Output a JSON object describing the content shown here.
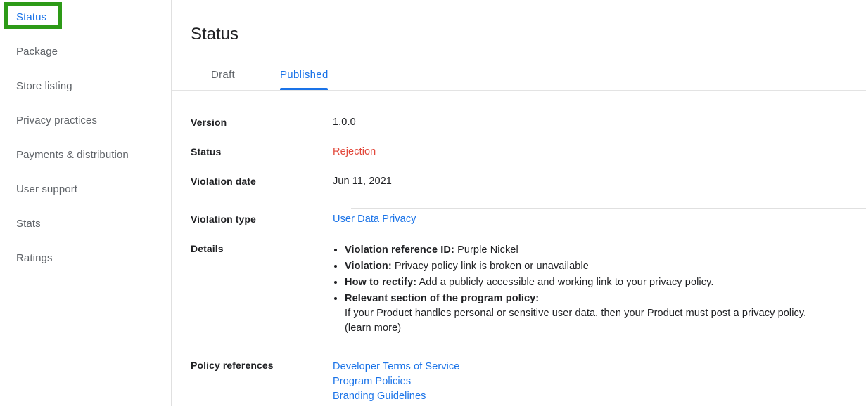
{
  "sidebar": {
    "items": [
      {
        "label": "Status",
        "active": true
      },
      {
        "label": "Package",
        "active": false
      },
      {
        "label": "Store listing",
        "active": false
      },
      {
        "label": "Privacy practices",
        "active": false
      },
      {
        "label": "Payments & distribution",
        "active": false
      },
      {
        "label": "User support",
        "active": false
      },
      {
        "label": "Stats",
        "active": false
      },
      {
        "label": "Ratings",
        "active": false
      }
    ],
    "highlight_color": "#2d9a17",
    "active_color": "#1a73e8"
  },
  "header": {
    "title": "Status"
  },
  "tabs": {
    "draft": "Draft",
    "published": "Published",
    "selected": "Published",
    "indicator_color": "#1a73e8"
  },
  "detail": {
    "version_label": "Version",
    "version_value": "1.0.0",
    "status_label": "Status",
    "status_value": "Rejection",
    "status_color": "#e2473a",
    "violation_date_label": "Violation date",
    "violation_date_value": "Jun 11, 2021",
    "violation_type_label": "Violation type",
    "violation_type_value": "User Data Privacy",
    "details_label": "Details",
    "details_bullets": [
      {
        "term": "Violation reference ID:",
        "text": " Purple Nickel"
      },
      {
        "term": "Violation:",
        "text": " Privacy policy link is broken or unavailable"
      },
      {
        "term": "How to rectify:",
        "text": " Add a publicly accessible and working link to your privacy policy."
      },
      {
        "term": "Relevant section of the program policy:",
        "text": ""
      }
    ],
    "program_policy_text": "If your Product handles personal or sensitive user data, then your Product must post a privacy policy.",
    "learn_more": "(learn more)",
    "policy_references_label": "Policy references",
    "policy_references": [
      "Developer Terms of Service",
      "Program Policies",
      "Branding Guidelines"
    ],
    "link_color": "#1a73e8"
  }
}
